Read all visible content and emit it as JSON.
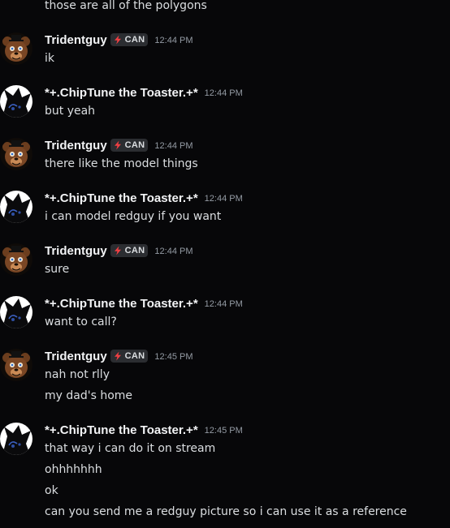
{
  "colors": {
    "background": "#070709",
    "username": "#f2f3f5",
    "message_text": "#dbdee1",
    "timestamp": "#949ba4",
    "tag_background": "#2b2d31",
    "tag_bolt": "#f23f43"
  },
  "top_fragment": "those are all of the polygons",
  "users": {
    "trident": {
      "name": "Tridentguy",
      "tag_icon": "lightning-bolt-icon",
      "tag_label": "CAN",
      "avatar": "brown-bear-avatar"
    },
    "chiptune": {
      "name": "*+.ChipTune the Toaster.+*",
      "avatar": "white-black-cartoon-avatar"
    }
  },
  "messages": [
    {
      "author": "Tridentguy",
      "tag": "CAN",
      "time": "12:44 PM",
      "lines": [
        "ik"
      ]
    },
    {
      "author": "*+.ChipTune the Toaster.+*",
      "time": "12:44 PM",
      "lines": [
        "but yeah"
      ]
    },
    {
      "author": "Tridentguy",
      "tag": "CAN",
      "time": "12:44 PM",
      "lines": [
        "there like the model things"
      ]
    },
    {
      "author": "*+.ChipTune the Toaster.+*",
      "time": "12:44 PM",
      "lines": [
        "i can model redguy if you want"
      ]
    },
    {
      "author": "Tridentguy",
      "tag": "CAN",
      "time": "12:44 PM",
      "lines": [
        "sure"
      ]
    },
    {
      "author": "*+.ChipTune the Toaster.+*",
      "time": "12:44 PM",
      "lines": [
        "want to call?"
      ]
    },
    {
      "author": "Tridentguy",
      "tag": "CAN",
      "time": "12:45 PM",
      "lines": [
        "nah not rlly",
        "my dad's home"
      ]
    },
    {
      "author": "*+.ChipTune the Toaster.+*",
      "time": "12:45 PM",
      "lines": [
        "that way i can do it on stream",
        "ohhhhhhh",
        "ok",
        "can you send me a redguy picture so i can use it as a reference"
      ]
    }
  ]
}
